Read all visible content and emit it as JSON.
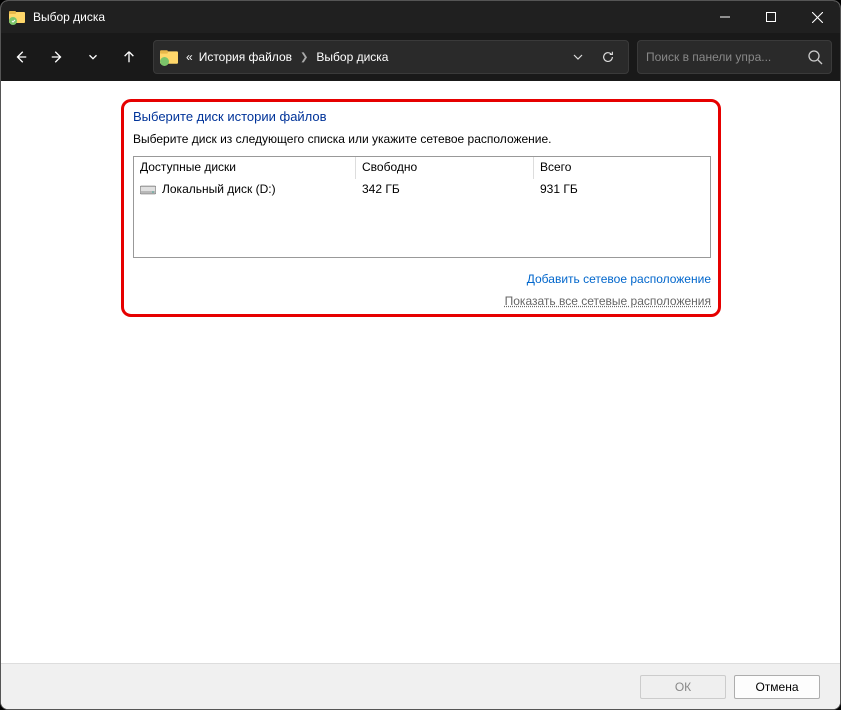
{
  "window": {
    "title": "Выбор диска"
  },
  "breadcrumb": {
    "prefix": "«",
    "level1": "История файлов",
    "level2": "Выбор диска"
  },
  "search": {
    "placeholder": "Поиск в панели упра..."
  },
  "panel": {
    "heading": "Выберите диск истории файлов",
    "description": "Выберите диск из следующего списка или укажите сетевое расположение."
  },
  "table": {
    "col1": "Доступные диски",
    "col2": "Свободно",
    "col3": "Всего",
    "rows": [
      {
        "name": "Локальный диск (D:)",
        "free": "342 ГБ",
        "total": "931 ГБ"
      }
    ]
  },
  "links": {
    "add_network": "Добавить сетевое расположение",
    "show_all": "Показать все сетевые расположения"
  },
  "footer": {
    "ok": "ОК",
    "cancel": "Отмена"
  }
}
